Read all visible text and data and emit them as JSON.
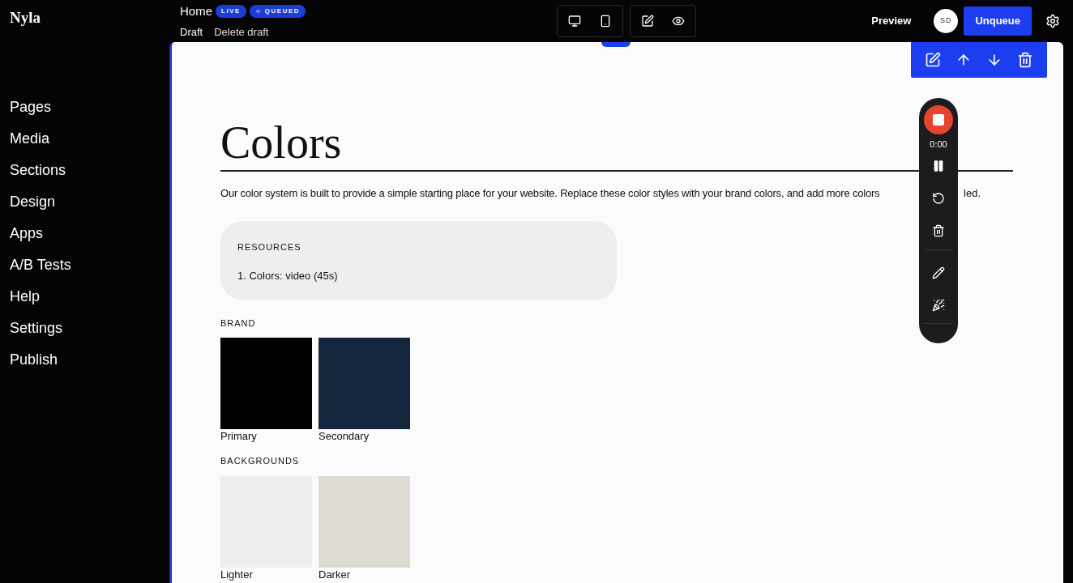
{
  "logo": "Nyla",
  "sidebar": {
    "items": [
      {
        "label": "Pages"
      },
      {
        "label": "Media"
      },
      {
        "label": "Sections"
      },
      {
        "label": "Design"
      },
      {
        "label": "Apps"
      },
      {
        "label": "A/B Tests"
      },
      {
        "label": "Help"
      },
      {
        "label": "Settings"
      },
      {
        "label": "Publish"
      }
    ]
  },
  "topbar": {
    "page_title": "Home",
    "badges": [
      {
        "label": "LIVE",
        "kind": "plain"
      },
      {
        "label": "QUEUED",
        "kind": "arrow"
      }
    ],
    "links": [
      "Draft",
      "Delete draft"
    ],
    "view_toggles": [
      {
        "kind": "desktop",
        "selected": false
      },
      {
        "kind": "mobile",
        "selected": false
      }
    ],
    "mode_toggles": [
      {
        "kind": "edit",
        "selected": false
      },
      {
        "kind": "preview",
        "selected": false
      }
    ],
    "preview": "Preview",
    "avatar": "SD",
    "primary_button": "Unqueue"
  },
  "section_toolbar": [
    {
      "kind": "edit"
    },
    {
      "kind": "up"
    },
    {
      "kind": "down"
    },
    {
      "kind": "delete"
    }
  ],
  "recorder": {
    "time": "0:00"
  },
  "content": {
    "title": "Colors",
    "description": "Our color system is built to provide a simple starting place for your website. Replace these color styles with your brand colors, and add more colors",
    "description_tail": "led.",
    "resources": {
      "heading": "RESOURCES",
      "items": [
        "1. Colors: video (45s)"
      ]
    },
    "groups": [
      {
        "heading": "BRAND",
        "swatches": [
          {
            "label": "Primary",
            "color": "#000000"
          },
          {
            "label": "Secondary",
            "color": "#13263d"
          }
        ]
      },
      {
        "heading": "BACKGROUNDS",
        "swatches": [
          {
            "label": "Lighter",
            "color": "#efeeec"
          },
          {
            "label": "Darker",
            "color": "#dedbd2"
          }
        ]
      }
    ]
  }
}
